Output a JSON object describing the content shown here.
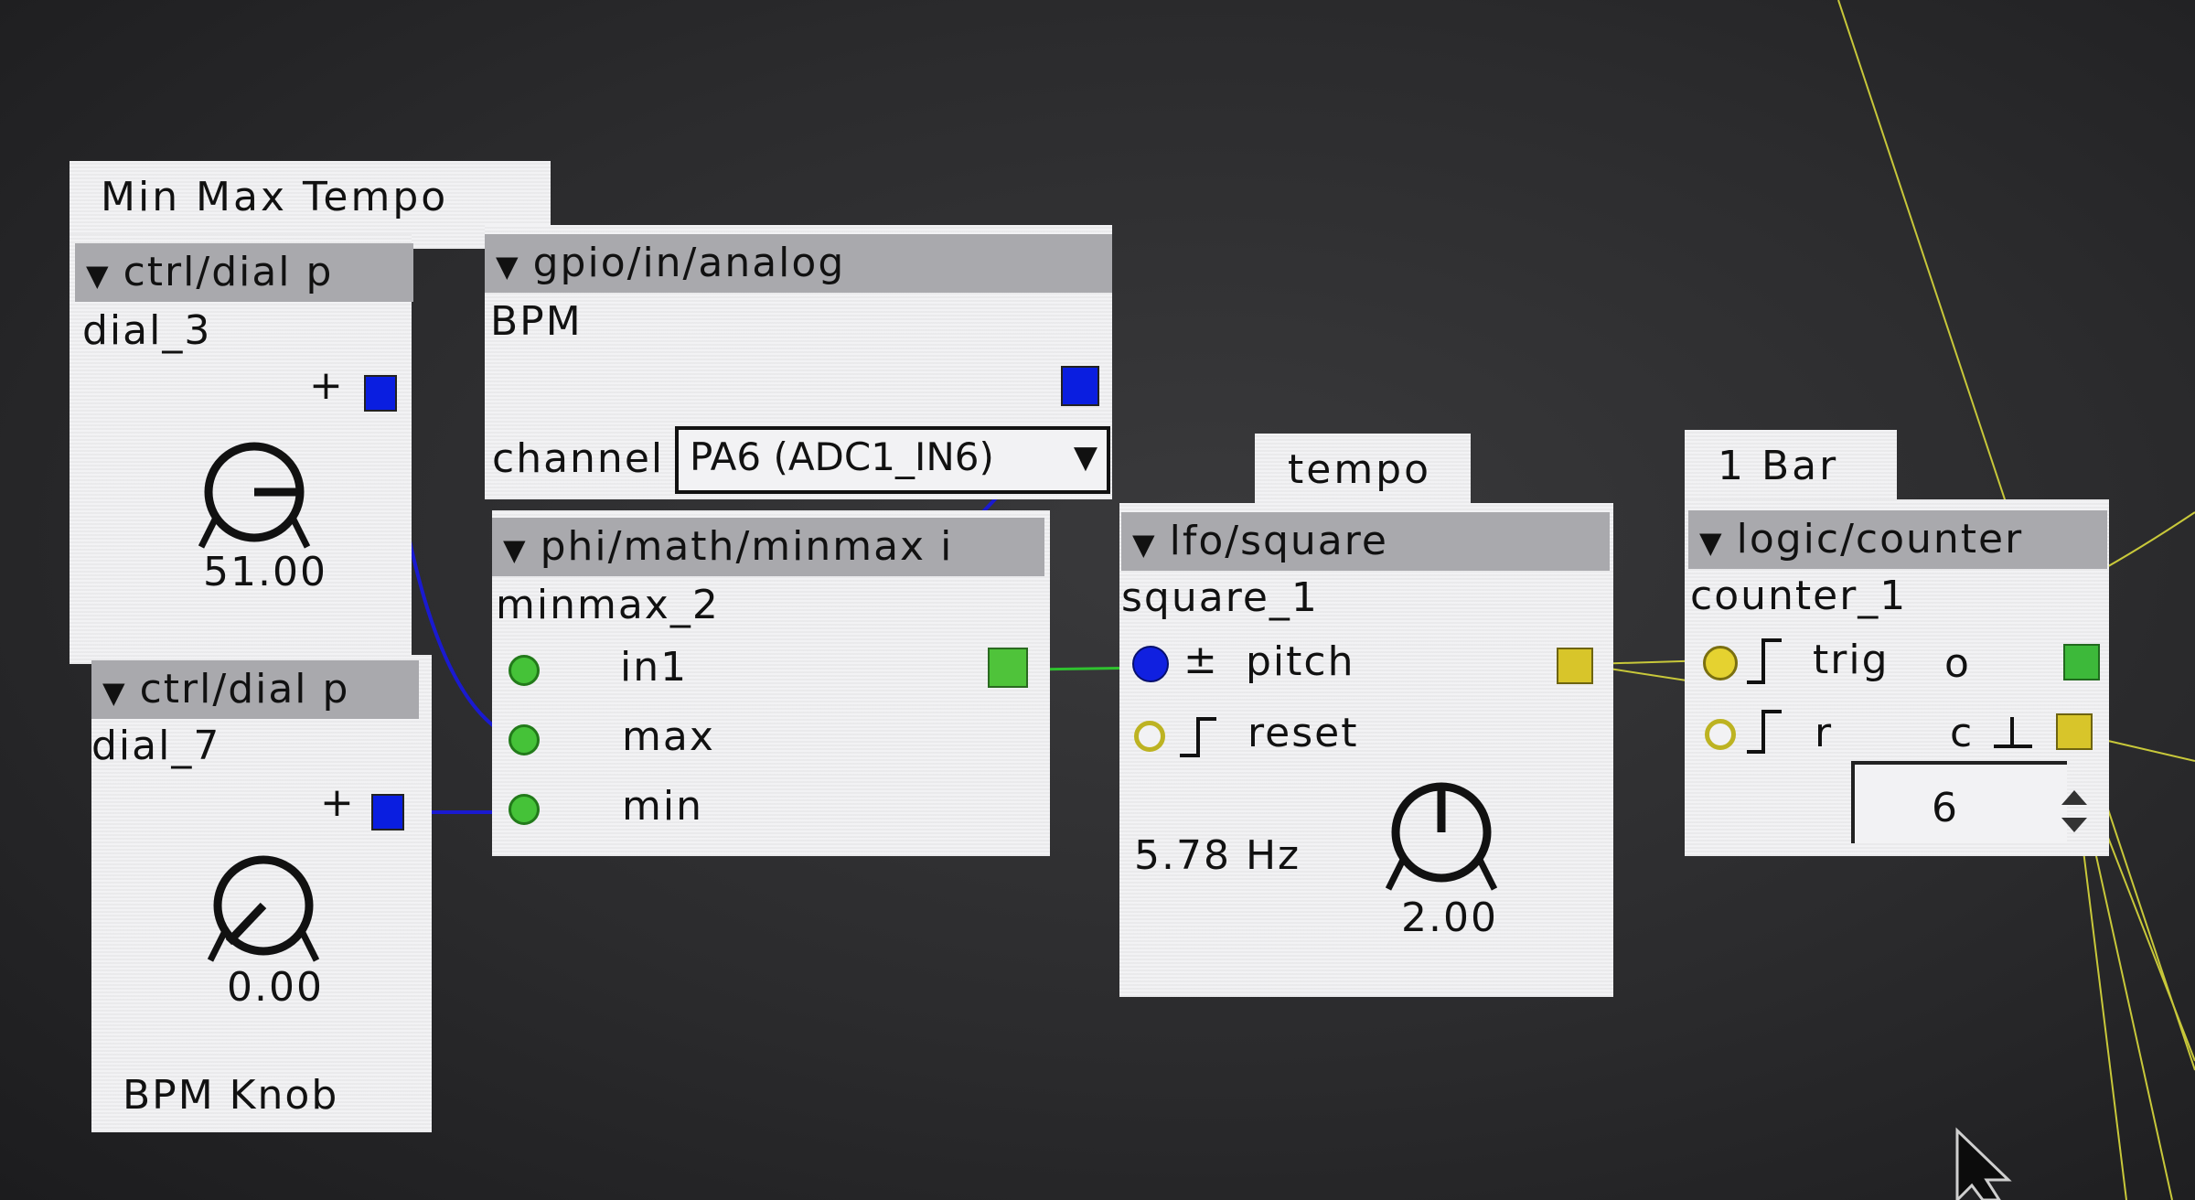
{
  "colors": {
    "canvas": "#2b2b2d",
    "object_bg": "#f2f2f4",
    "header_bg": "#a9a9ad",
    "blue_wire": "#1a1ad0",
    "green_wire": "#2fc22f",
    "yellow_wire": "#c8c83a",
    "blue_port": "#0a1ee0",
    "green_port": "#4fc33a",
    "yellow_port": "#d8c52a"
  },
  "groups": {
    "min_max_tempo": {
      "title": "Min Max Tempo"
    },
    "tempo": {
      "title": "tempo"
    },
    "one_bar": {
      "title": "1 Bar"
    }
  },
  "objects": {
    "dial_3": {
      "type": "ctrl/dial p",
      "name": "dial_3",
      "plus": "+",
      "value": "51.00",
      "knob_level": 0.51
    },
    "dial_7": {
      "type": "ctrl/dial p",
      "name": "dial_7",
      "plus": "+",
      "value": "0.00",
      "knob_level": 0.0
    },
    "bpm_knob_label": "BPM Knob",
    "analog": {
      "type": "gpio/in/analog",
      "name": "BPM",
      "param_label": "channel",
      "channel_value": "PA6 (ADC1_IN6)"
    },
    "minmax": {
      "type": "phi/math/minmax i",
      "name": "minmax_2",
      "inlets": [
        "in1",
        "max",
        "min"
      ]
    },
    "square": {
      "type": "lfo/square",
      "name": "square_1",
      "pitch_prefix": "±",
      "pitch_label": "pitch",
      "reset_label": "reset",
      "freq": "5.78 Hz",
      "value": "2.00"
    },
    "counter": {
      "type": "logic/counter",
      "name": "counter_1",
      "trig_label": "trig",
      "r_label": "r",
      "o_label": "o",
      "c_label": "c",
      "count": "6"
    }
  },
  "icons": {
    "collapse": "▼",
    "dropdown_arrow": "▼",
    "spinner": "up-down-arrows-icon",
    "mouse_cursor": "arrow-cursor-icon"
  }
}
